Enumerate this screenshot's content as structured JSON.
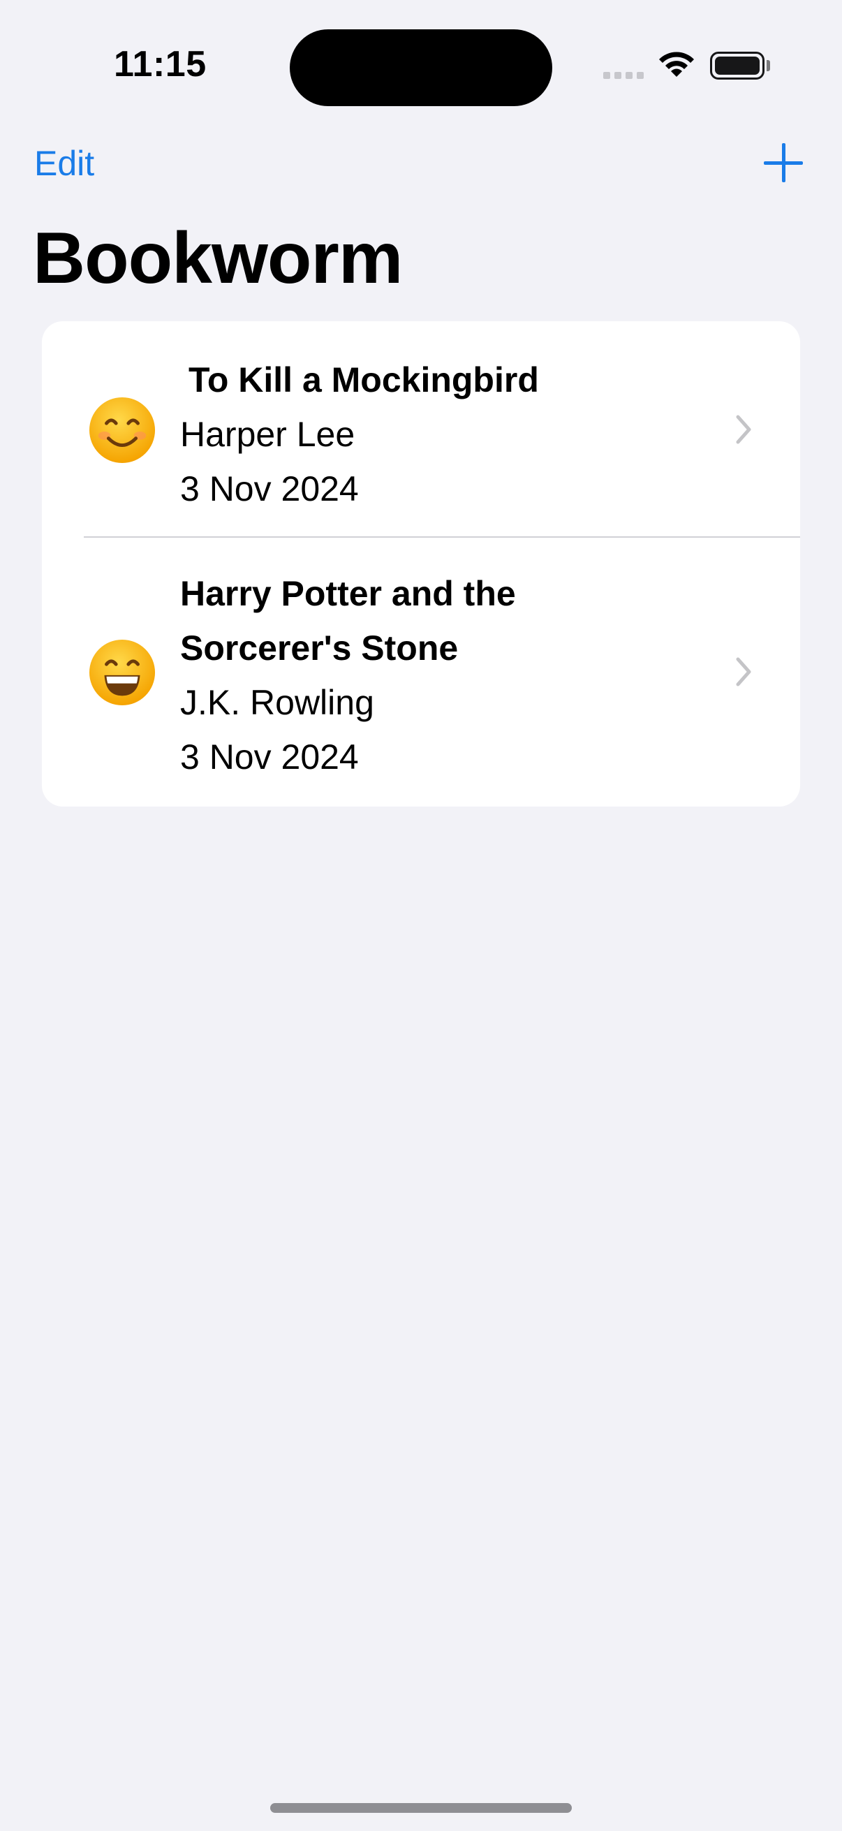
{
  "status_bar": {
    "time": "11:15"
  },
  "nav": {
    "edit_label": "Edit",
    "add_icon": "plus-icon",
    "title": "Bookworm"
  },
  "books": [
    {
      "title_lines": [
        "To Kill a Mockingbird"
      ],
      "author": "Harper Lee",
      "date": "3 Nov 2024",
      "rating_emoji": "smiling-face-icon"
    },
    {
      "title_lines": [
        "Harry Potter and the",
        "Sorcerer's Stone"
      ],
      "author": "J.K. Rowling",
      "date": "3 Nov 2024",
      "rating_emoji": "grinning-face-icon"
    }
  ],
  "colors": {
    "accent": "#1a7ce8",
    "background": "#f2f2f7",
    "card": "#ffffff"
  }
}
